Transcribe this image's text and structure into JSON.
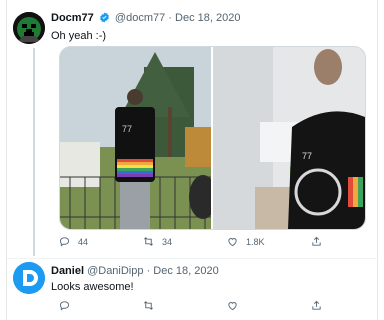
{
  "tweet1": {
    "name": "Docm77",
    "handle": "@docm77",
    "date": "Dec 18, 2020",
    "text": "Oh yeah :-)",
    "replies": "44",
    "retweets": "34",
    "likes": "1.8K",
    "verified_color": "#1d9bf0"
  },
  "tweet2": {
    "name": "Daniel",
    "handle": "@DaniDipp",
    "date": "Dec 18, 2020",
    "text": "Looks awesome!"
  },
  "icons": [
    "reply-icon",
    "retweet-icon",
    "like-icon",
    "share-icon"
  ],
  "colors": {
    "muted": "#536471",
    "border": "#cfd9de",
    "avatar2": "#1d9bf0"
  }
}
